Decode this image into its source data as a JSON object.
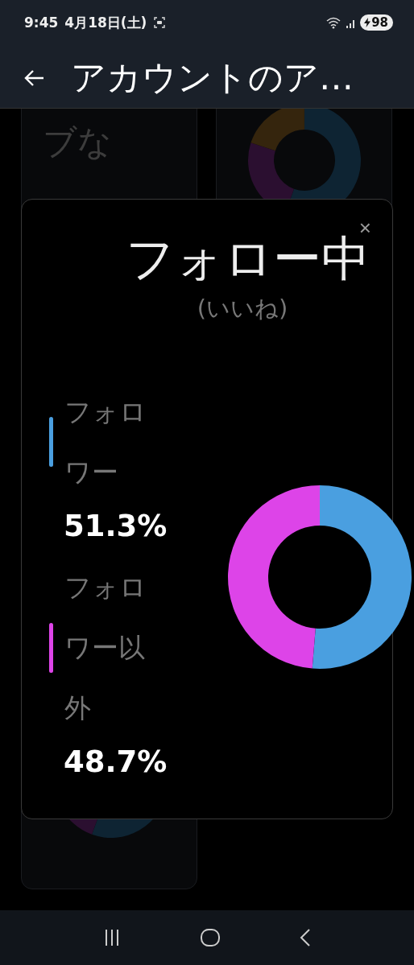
{
  "status_bar": {
    "time": "9:45",
    "date": "4月18日(土)",
    "battery": "98"
  },
  "app_bar": {
    "title": "アカウントのア…"
  },
  "background_cards": [
    {
      "kind": "text",
      "text": "ブな"
    },
    {
      "kind": "donut"
    }
  ],
  "dialog": {
    "close": "×",
    "title": "フォロー中",
    "subtitle": "(いいね)",
    "legend": [
      {
        "value": "51.3%",
        "color": "#4a9fe0"
      },
      {
        "value": "48.7%",
        "color": "#dd44e8"
      }
    ],
    "chart_data": {
      "type": "donut",
      "categories": [
        "フォロワー",
        "フォロワー以外"
      ],
      "values": [
        51.3,
        48.7
      ]
    }
  }
}
